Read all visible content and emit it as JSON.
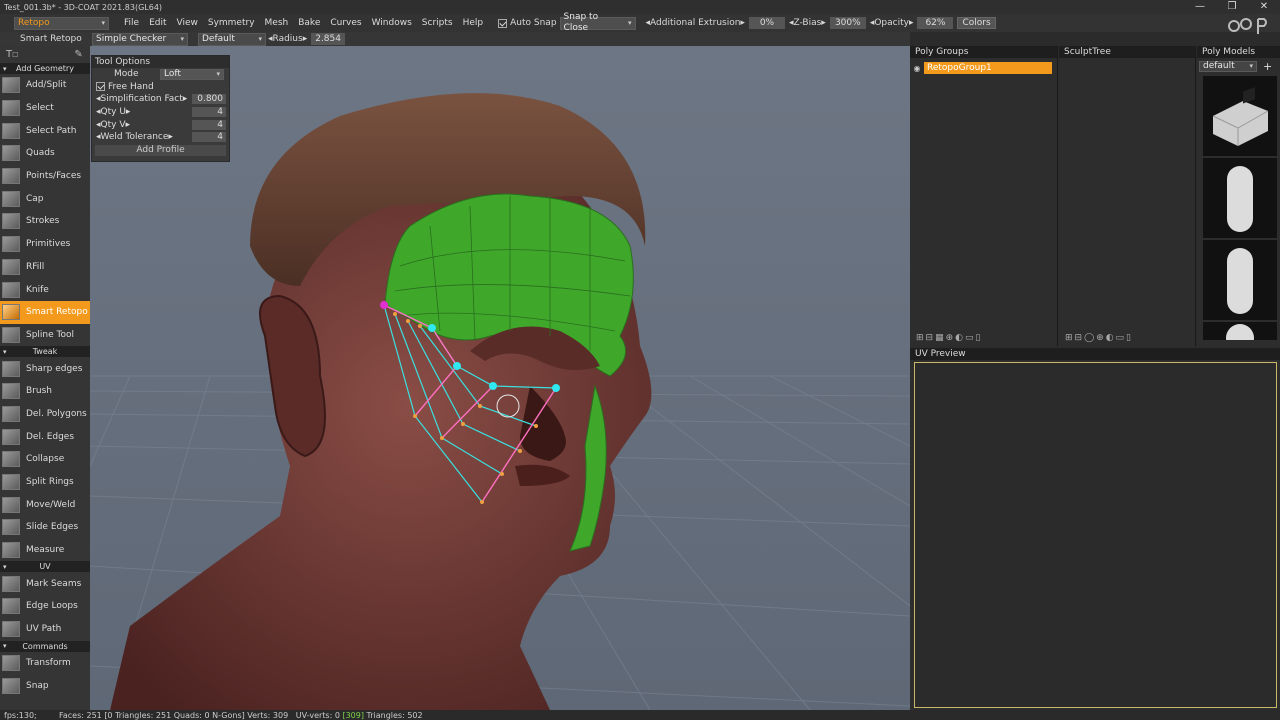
{
  "window": {
    "title": "Test_001.3b* - 3D-COAT 2021.83(GL64)",
    "controls": [
      "—",
      "❐",
      "✕"
    ]
  },
  "menubar": {
    "room": "Retopo",
    "menus": [
      "File",
      "Edit",
      "View",
      "Symmetry",
      "Mesh",
      "Bake",
      "Curves",
      "Windows",
      "Scripts",
      "Help"
    ],
    "auto_snap_label": "Auto Snap",
    "auto_snap_checked": true,
    "snap_mode": "Snap to Close",
    "additional_extrusion_label": "◂Additional Extrusion▸",
    "additional_extrusion_value": "0%",
    "zbias_label": "◂Z-Bias▸",
    "zbias_value": "300%",
    "opacity_label": "◂Opacity▸",
    "opacity_value": "62%",
    "colors_label": "Colors"
  },
  "subbar": {
    "tool_name": "Smart Retopo",
    "shader": "Simple Checker",
    "preset": "Default",
    "radius_label": "◂Radius▸",
    "radius_value": "2.854"
  },
  "leftbar": {
    "sections": [
      {
        "title": "Add Geometry",
        "tools": [
          "Add/Split",
          "Select",
          "Select Path",
          "Quads",
          "Points/Faces",
          "Cap",
          "Strokes",
          "Primitives",
          "RFill",
          "Knife",
          "Smart Retopo",
          "Spline Tool"
        ]
      },
      {
        "title": "Tweak",
        "tools": [
          "Sharp edges",
          "Brush",
          "Del. Polygons",
          "Del. Edges",
          "Collapse",
          "Split Rings",
          "Move/Weld",
          "Slide Edges",
          "Measure"
        ]
      },
      {
        "title": "UV",
        "tools": [
          "Mark Seams",
          "Edge Loops",
          "UV Path"
        ]
      },
      {
        "title": "Commands",
        "tools": [
          "Transform",
          "Snap"
        ]
      }
    ],
    "active_tool": "Smart Retopo"
  },
  "tool_options": {
    "title": "Tool Options",
    "mode_label": "Mode",
    "mode_value": "Loft",
    "free_hand_label": "Free Hand",
    "free_hand_checked": true,
    "rows": [
      {
        "label": "◂Simplification Fact▸",
        "value": "0.800"
      },
      {
        "label": "◂Qty U▸",
        "value": "4"
      },
      {
        "label": "◂Qty V▸",
        "value": "4"
      },
      {
        "label": "◂Weld Tolerance▸",
        "value": "4"
      }
    ],
    "add_profile_label": "Add Profile"
  },
  "panels": {
    "poly_groups_title": "Poly Groups",
    "poly_group_item": "RetopoGroup1",
    "sculpt_tree_title": "SculptTree",
    "poly_models_title": "Poly Models",
    "poly_models_preset": "default",
    "uv_preview_title": "UV Preview"
  },
  "statusbar": {
    "fps": "fps:130;",
    "faces": "Faces: 251",
    "bracket_open": "[0",
    "triangles": "Triangles: 251",
    "quads": "Quads: 0",
    "ngons": "N-Gons]",
    "verts": "Verts: 309",
    "uv_verts": "UV-verts: 0",
    "uv_highlight": "[309]",
    "triangles2": "Triangles: 502"
  },
  "colors": {
    "accent": "#f39a1c",
    "mesh_green": "#3fa82b",
    "skin": "#6e3a36",
    "hair": "#5a3a2c"
  }
}
